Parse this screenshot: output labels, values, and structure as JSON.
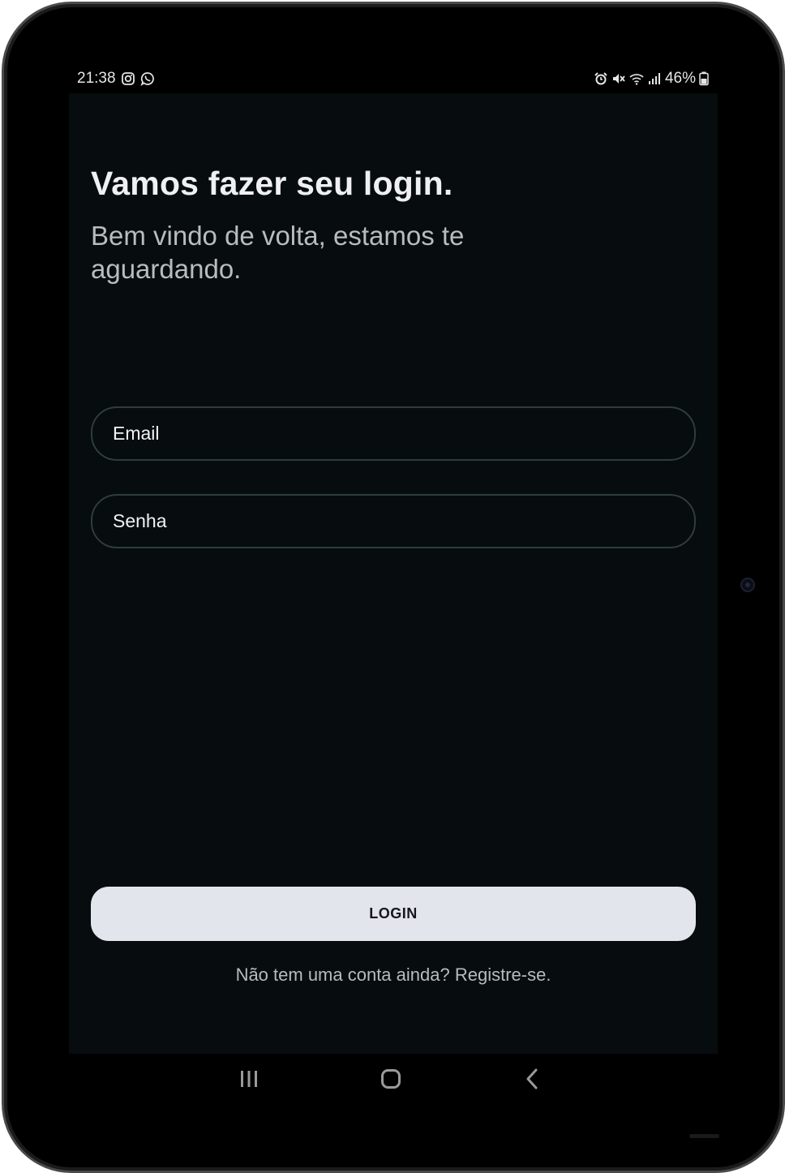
{
  "status_bar": {
    "time": "21:38",
    "left_icons": [
      "instagram-icon",
      "whatsapp-icon"
    ],
    "right_icons": [
      "alarm-icon",
      "mute-icon",
      "wifi-icon",
      "signal-icon"
    ],
    "battery": "46%"
  },
  "login": {
    "title": "Vamos fazer seu login.",
    "subtitle": "Bem vindo de volta, estamos te aguardando.",
    "email_placeholder": "Email",
    "password_placeholder": "Senha",
    "login_button": "LOGIN",
    "register_text": "Não tem uma conta ainda? Registre-se."
  },
  "nav_bar": {
    "icons": [
      "recent-apps-icon",
      "home-icon",
      "back-icon"
    ]
  },
  "colors": {
    "screen_background": "#070c0e",
    "field_border": "#2e3d3a",
    "button_background": "#e2e5ec",
    "title_text": "#eef0f2",
    "subtitle_text": "#b9bcbf"
  }
}
